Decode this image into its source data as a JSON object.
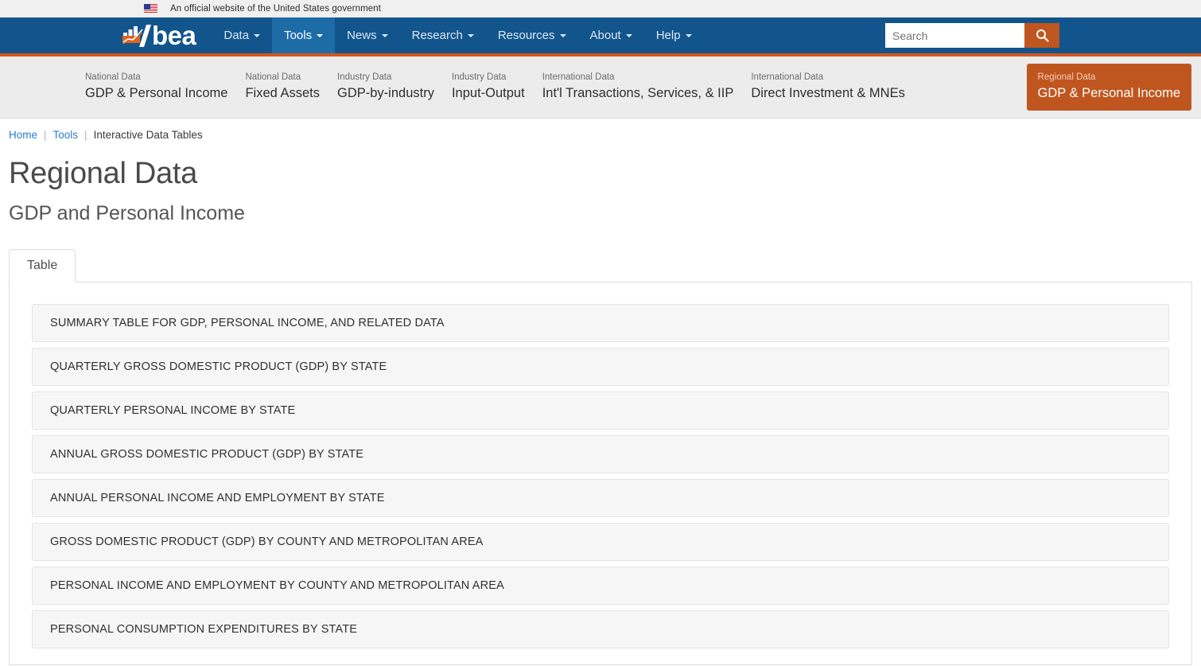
{
  "gov_banner": {
    "text": "An official website of the United States government",
    "flag_icon": "us-flag-icon"
  },
  "header": {
    "logo_text": "bea",
    "logo_icon": "bea-chart-logo-icon",
    "nav_items": [
      {
        "label": "Data",
        "active": false,
        "has_caret": true
      },
      {
        "label": "Tools",
        "active": true,
        "has_caret": true
      },
      {
        "label": "News",
        "active": false,
        "has_caret": true
      },
      {
        "label": "Research",
        "active": false,
        "has_caret": true
      },
      {
        "label": "Resources",
        "active": false,
        "has_caret": true
      },
      {
        "label": "About",
        "active": false,
        "has_caret": true
      },
      {
        "label": "Help",
        "active": false,
        "has_caret": true
      }
    ],
    "search": {
      "placeholder": "Search",
      "value": "",
      "button_icon": "search-icon"
    },
    "colors": {
      "header_blue": "#11558c",
      "active_blue": "#1d6ca8",
      "accent_orange": "#d2571e",
      "search_button_orange": "#c0561f"
    }
  },
  "subnav": {
    "items": [
      {
        "category": "National Data",
        "title": "GDP & Personal Income",
        "active": false
      },
      {
        "category": "National Data",
        "title": "Fixed Assets",
        "active": false
      },
      {
        "category": "Industry Data",
        "title": "GDP-by-industry",
        "active": false
      },
      {
        "category": "Industry Data",
        "title": "Input-Output",
        "active": false
      },
      {
        "category": "International Data",
        "title": "Int'l Transactions, Services, & IIP",
        "active": false
      },
      {
        "category": "International Data",
        "title": "Direct Investment & MNEs",
        "active": false
      },
      {
        "category": "Regional Data",
        "title": "GDP & Personal Income",
        "active": true
      }
    ]
  },
  "breadcrumb": {
    "items": [
      {
        "label": "Home",
        "link": true
      },
      {
        "label": "Tools",
        "link": true
      },
      {
        "label": "Interactive Data Tables",
        "link": false
      }
    ],
    "separator": "|"
  },
  "page": {
    "title": "Regional Data",
    "subtitle": "GDP and Personal Income"
  },
  "tabs": [
    {
      "label": "Table",
      "active": true
    }
  ],
  "table_list": [
    {
      "label": "SUMMARY TABLE FOR GDP, PERSONAL INCOME, AND RELATED DATA"
    },
    {
      "label": "QUARTERLY GROSS DOMESTIC PRODUCT (GDP) BY STATE"
    },
    {
      "label": "QUARTERLY PERSONAL INCOME BY STATE"
    },
    {
      "label": "ANNUAL GROSS DOMESTIC PRODUCT (GDP) BY STATE"
    },
    {
      "label": "ANNUAL PERSONAL INCOME AND EMPLOYMENT BY STATE"
    },
    {
      "label": "GROSS DOMESTIC PRODUCT (GDP) BY COUNTY AND METROPOLITAN AREA"
    },
    {
      "label": "PERSONAL INCOME AND EMPLOYMENT BY COUNTY AND METROPOLITAN AREA"
    },
    {
      "label": "PERSONAL CONSUMPTION EXPENDITURES BY STATE"
    }
  ]
}
